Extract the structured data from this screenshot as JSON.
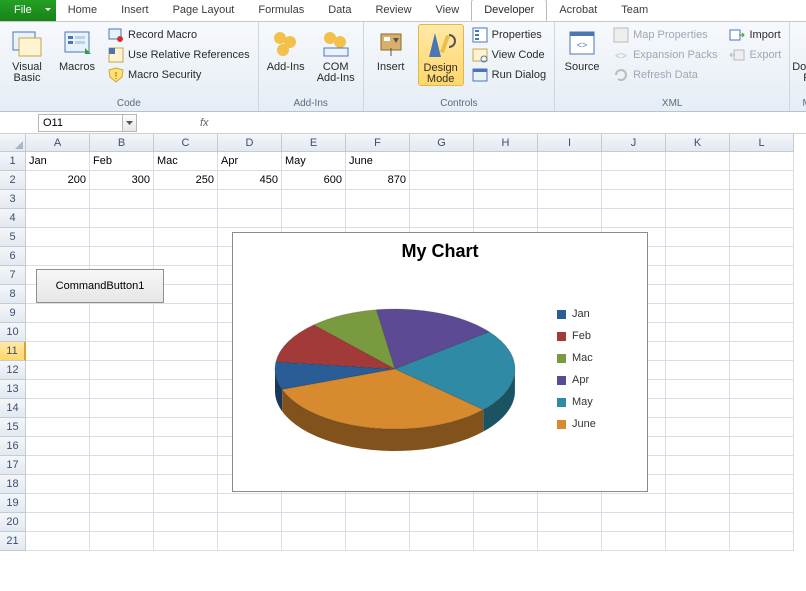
{
  "tabs": {
    "file": "File",
    "items": [
      "Home",
      "Insert",
      "Page Layout",
      "Formulas",
      "Data",
      "Review",
      "View",
      "Developer",
      "Acrobat",
      "Team"
    ],
    "active": "Developer"
  },
  "ribbon": {
    "code": {
      "visual_basic": "Visual\nBasic",
      "macros": "Macros",
      "record_macro": "Record Macro",
      "use_rel_refs": "Use Relative References",
      "macro_security": "Macro Security",
      "label": "Code"
    },
    "addins": {
      "addins": "Add-Ins",
      "com": "COM\nAdd-Ins",
      "label": "Add-Ins"
    },
    "controls": {
      "insert": "Insert",
      "design_mode": "Design\nMode",
      "properties": "Properties",
      "view_code": "View Code",
      "run_dialog": "Run Dialog",
      "label": "Controls"
    },
    "xml": {
      "source": "Source",
      "map_props": "Map Properties",
      "expansion": "Expansion Packs",
      "refresh": "Refresh Data",
      "import": "Import",
      "export": "Export",
      "label": "XML"
    },
    "modify": {
      "doc_panel": "Document\nPanel",
      "label": "Modify"
    }
  },
  "namebox": "O11",
  "fx_label": "fx",
  "columns": [
    "A",
    "B",
    "C",
    "D",
    "E",
    "F",
    "G",
    "H",
    "I",
    "J",
    "K",
    "L"
  ],
  "row_numbers": [
    "1",
    "2",
    "3",
    "4",
    "5",
    "6",
    "7",
    "8",
    "9",
    "10",
    "11",
    "12",
    "13",
    "14",
    "15",
    "16",
    "17",
    "18",
    "19",
    "20",
    "21"
  ],
  "selected_row": "11",
  "data_rows": {
    "1": [
      "Jan",
      "Feb",
      "Mac",
      "Apr",
      "May",
      "June",
      "",
      "",
      "",
      "",
      "",
      ""
    ],
    "2": [
      "200",
      "300",
      "250",
      "450",
      "600",
      "870",
      "",
      "",
      "",
      "",
      "",
      ""
    ]
  },
  "command_button": "CommandButton1",
  "chart_data": {
    "type": "pie",
    "title": "My Chart",
    "categories": [
      "Jan",
      "Feb",
      "Mac",
      "Apr",
      "May",
      "June"
    ],
    "values": [
      200,
      300,
      250,
      450,
      600,
      870
    ],
    "colors": [
      "#2a5c95",
      "#a23a3a",
      "#7a9a3f",
      "#5d4a94",
      "#2f8ba5",
      "#d88a2f"
    ]
  }
}
